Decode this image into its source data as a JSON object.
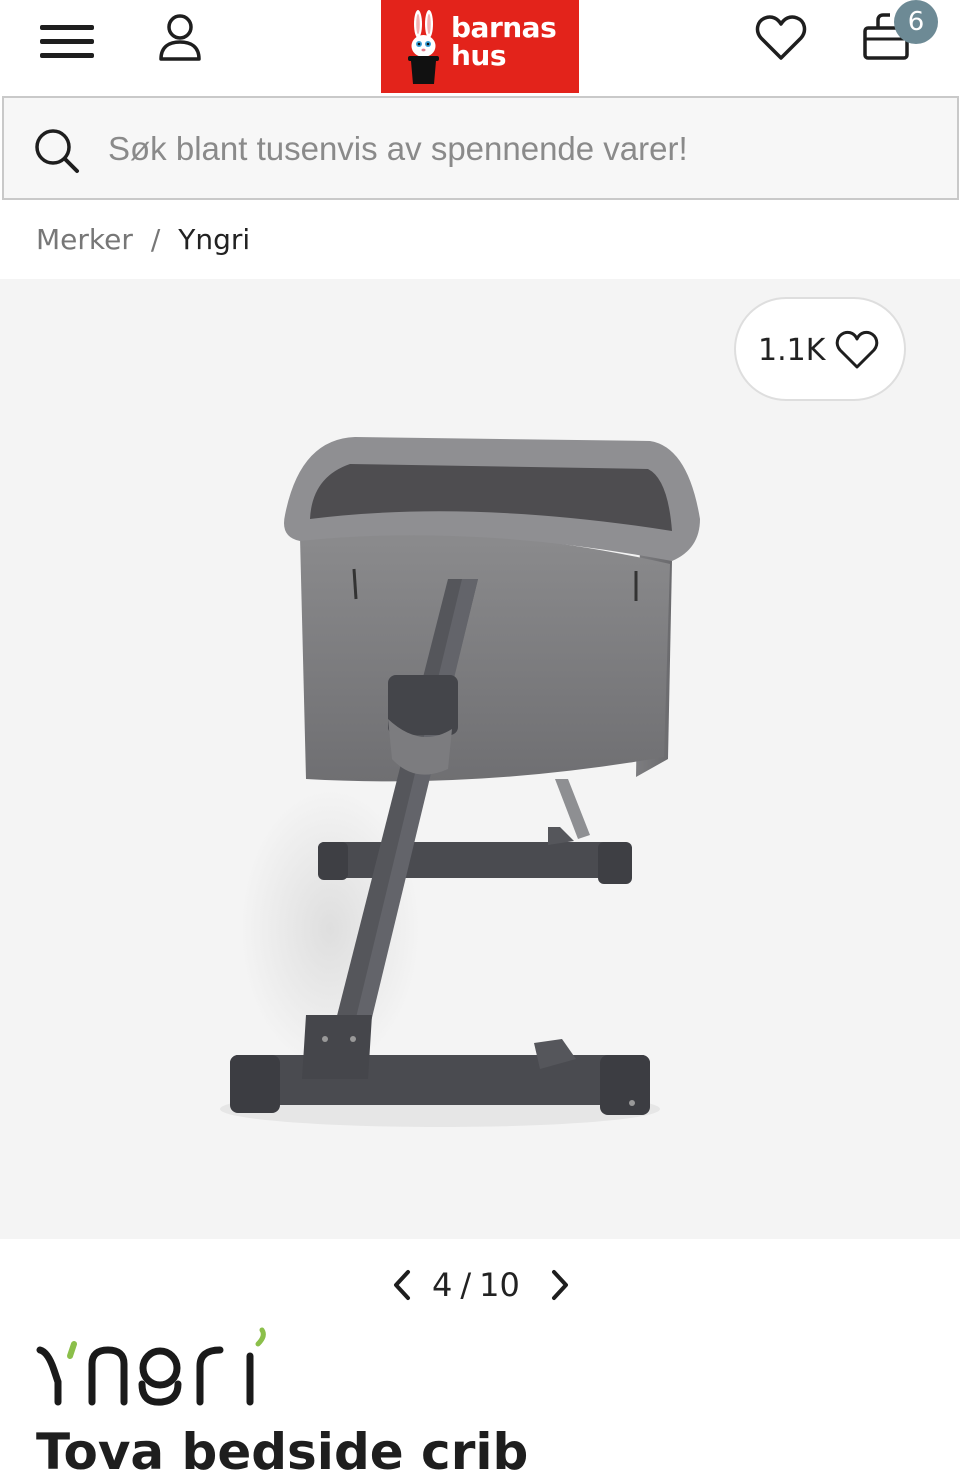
{
  "header": {
    "logo_line1": "barnas",
    "logo_line2": "hus",
    "cart_count": "6",
    "brand_color": "#e3231b",
    "badge_color": "#6d8a95",
    "icons": [
      "menu-icon",
      "user-icon",
      "heart-icon",
      "shopping-bag-icon"
    ]
  },
  "search": {
    "placeholder": "Søk blant tusenvis av spennende varer!",
    "value": ""
  },
  "breadcrumb": {
    "items": [
      "Merker",
      "Yngri"
    ],
    "separator": "/"
  },
  "gallery": {
    "like_count": "1.1K",
    "current": "4",
    "separator": "/",
    "total": "10",
    "background": "#f4f4f4"
  },
  "product": {
    "brand": "Yngri",
    "title": "Tova bedside crib"
  }
}
